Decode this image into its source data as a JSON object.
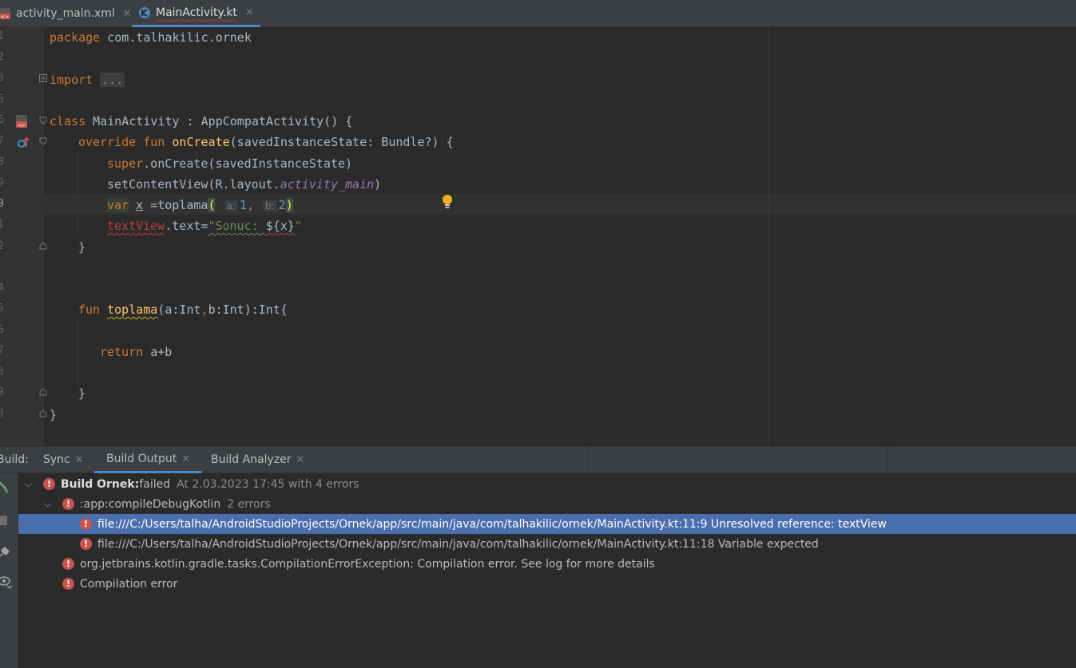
{
  "editor_tabs": [
    {
      "label": "activity_main.xml",
      "icon": "xml-file-icon",
      "active": false
    },
    {
      "label": "MainActivity.kt",
      "icon": "kotlin-file-icon",
      "active": true
    }
  ],
  "line_numbers": [
    "1",
    "2",
    "3",
    "5",
    "6",
    "7",
    "8",
    "9",
    "0",
    "1",
    "2",
    "4",
    "5",
    "6",
    "7",
    "8",
    "9",
    "0"
  ],
  "code": {
    "l1": {
      "kw": "package",
      "rest": " com.talhakilic.ornek"
    },
    "l3": {
      "kw": "import",
      "chip": "..."
    },
    "l6": {
      "kw": "class",
      "rest": " MainActivity : AppCompatActivity() {"
    },
    "l7": {
      "kw1": "override",
      "kw2": "fun",
      "fn": "onCreate",
      "rest": "(savedInstanceState: Bundle?) {"
    },
    "l8": {
      "kw": "super",
      "rest": ".onCreate(savedInstanceState)"
    },
    "l9": {
      "pre": "setContentView(R.layout.",
      "field": "activity_main",
      "post": ")"
    },
    "l10": {
      "kw": "var",
      "var": "x",
      "mid": " =toplama",
      "open": "(",
      "hint_a": "a:",
      "arg1": "1",
      "comma": ",",
      "hint_b": "b:",
      "arg2": "2",
      "close": ")"
    },
    "l11": {
      "err": "textView",
      "mid": ".text=",
      "str1": "\"Sonuc: ",
      "tmpl": "${x}",
      "str2": "\""
    },
    "l12": {
      "text": "}"
    },
    "l15": {
      "kw": "fun",
      "fn": "toplama",
      "rest": "(a:Int",
      "comma": ",",
      "rest2": "b:Int):Int{"
    },
    "l17": {
      "kw": "return",
      "rest": " a+b"
    },
    "l19": {
      "text": "}"
    },
    "l20": {
      "text": "}"
    }
  },
  "build_panel": {
    "title": "Build:",
    "tabs": [
      {
        "label": "Sync"
      },
      {
        "label": "Build Output"
      },
      {
        "label": "Build Analyzer"
      }
    ],
    "rows": [
      {
        "bold": "Build Ornek:",
        "text": " failed",
        "muted": "At 2.03.2023 17:45 with 4 errors"
      },
      {
        "text": ":app:compileDebugKotlin",
        "muted": "2 errors"
      },
      {
        "text": "file:///C:/Users/talha/AndroidStudioProjects/Ornek/app/src/main/java/com/talhakilic/ornek/MainActivity.kt:11:9 Unresolved reference: textView"
      },
      {
        "text": "file:///C:/Users/talha/AndroidStudioProjects/Ornek/app/src/main/java/com/talhakilic/ornek/MainActivity.kt:11:18 Variable expected"
      },
      {
        "text": "org.jetbrains.kotlin.gradle.tasks.CompilationErrorException: Compilation error. See log for more details"
      },
      {
        "text": "Compilation error"
      }
    ]
  },
  "colors": {
    "accent": "#4a88c7",
    "error": "#c75450",
    "keyword": "#cc7832",
    "function": "#ffc66d",
    "string": "#6a8759",
    "number": "#6897bb"
  }
}
